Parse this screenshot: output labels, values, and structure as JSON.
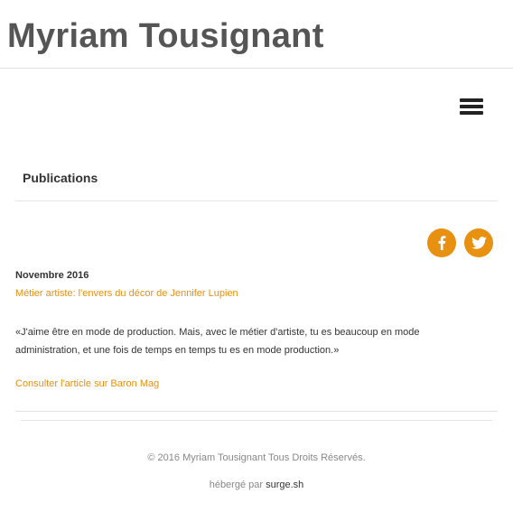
{
  "header": {
    "site_title": "Myriam Tousignant",
    "menu_icon": "hamburger-menu-icon"
  },
  "main": {
    "section_title": "Publications",
    "social": {
      "facebook_icon": "facebook-icon",
      "twitter_icon": "twitter-icon",
      "accent_color": "#e8900f"
    },
    "article": {
      "date": "Novembre 2016",
      "title_link": "Métier artiste: l'envers du décor de Jennifer Lupien",
      "quote_line1": "«J'aime être en mode de production. Mais, avec le métier d'artiste, tu es beaucoup en mode",
      "quote_line2": "administration, et une fois de temps en temps tu es en mode production.»",
      "consult_link": "Consulter l'article sur Baron Mag"
    }
  },
  "footer": {
    "copyright": "© 2016 Myriam Tousignant Tous Droits Réservés.",
    "hosted_prefix": "hébergé par ",
    "hosted_link": "surge.sh"
  }
}
